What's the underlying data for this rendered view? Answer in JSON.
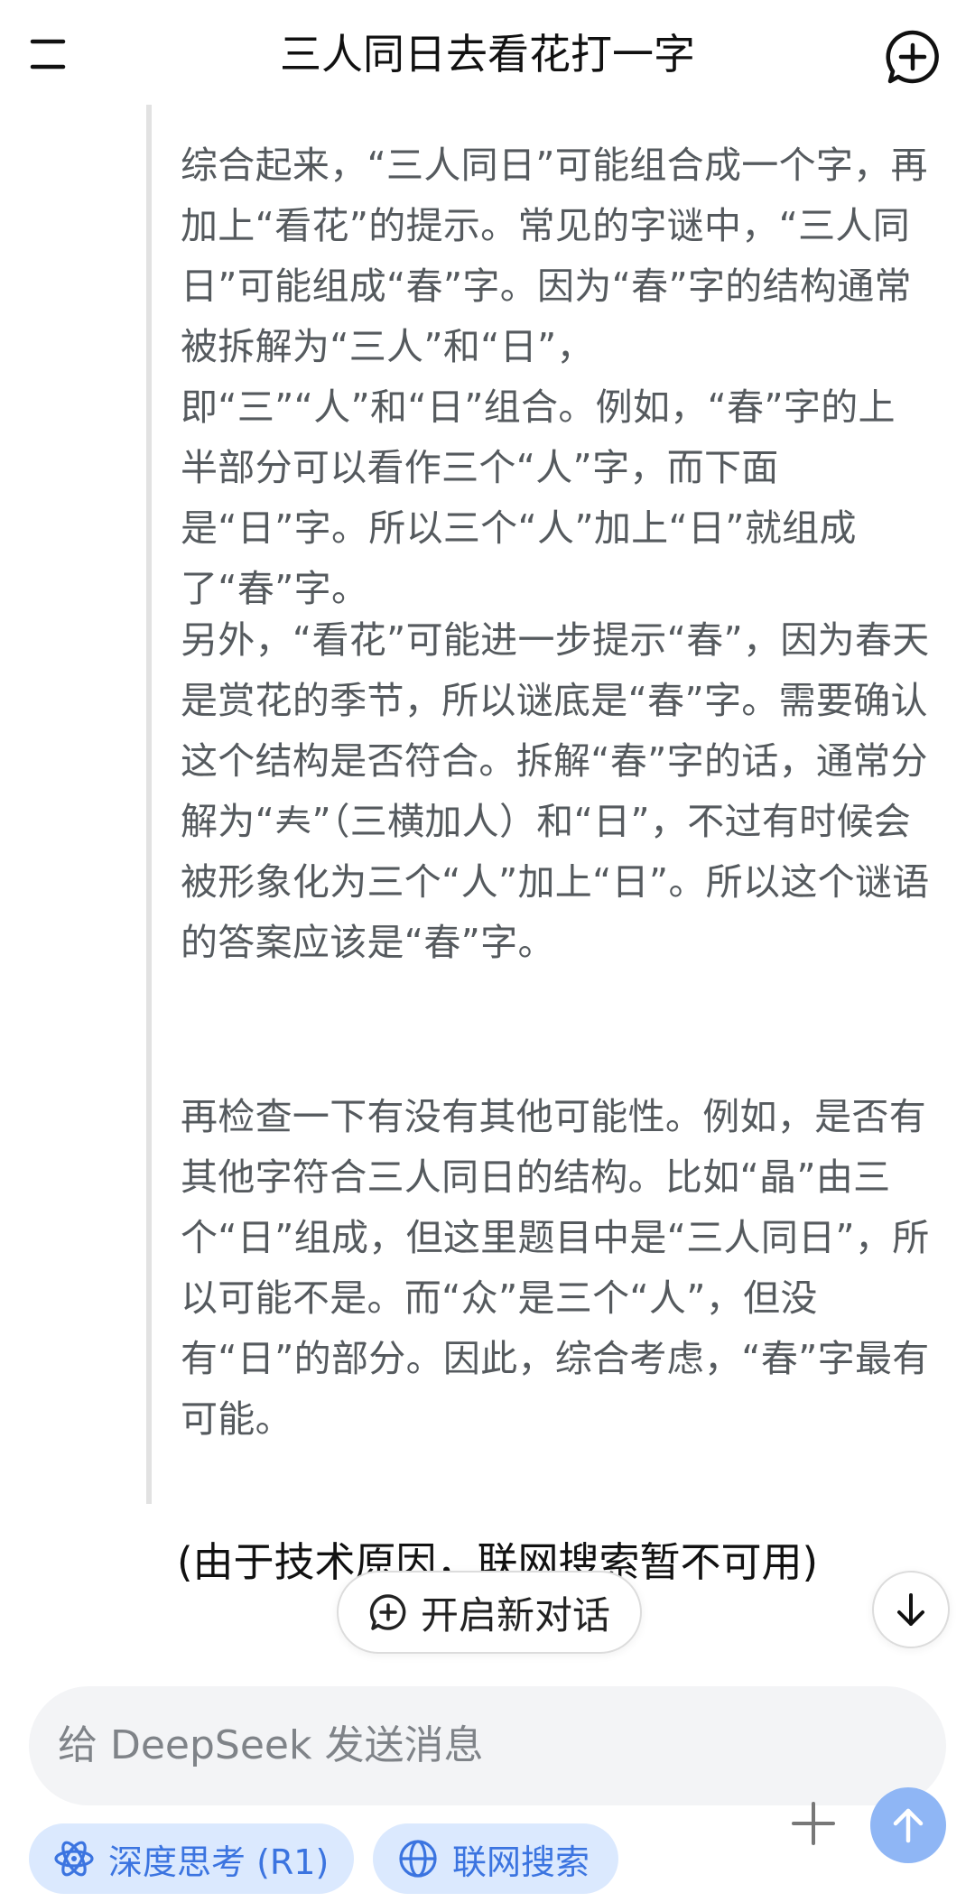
{
  "header": {
    "title": "三人同日去看花打一字"
  },
  "thinking": {
    "paragraphs": [
      "综合起来，“三人同日”可能组合成一个字，再加上“看花”的提示。常见的字谜中，“三人同日”可能组成“春”字。因为“春”字的结构通常被拆解为“三人”和“日”，即“三”“人”和“日”组合。例如，“春”字的上半部分可以看作三个“人”字，而下面是“日”字。所以三个“人”加上“日”就组成了“春”字。",
      "另外，“看花”可能进一步提示“春”，因为春天是赏花的季节，所以谜底是“春”字。需要确认这个结构是否符合。拆解“春”字的话，通常分解为“𡗗”（三横加人）和“日”，不过有时候会被形象化为三个“人”加上“日”。所以这个谜语的答案应该是“春”字。",
      "再检查一下有没有其他可能性。例如，是否有其他字符合三人同日的结构。比如“晶”由三个“日”组成，但这里题目中是“三人同日”，所以可能不是。而“众”是三个“人”，但没有“日”的部分。因此，综合考虑，“春”字最有可能。"
    ]
  },
  "answer": {
    "text": "(由于技术原因，联网搜索暂不可用)"
  },
  "floating": {
    "new_dialog_label": "开启新对话"
  },
  "composer": {
    "placeholder": "给 DeepSeek 发送消息",
    "deep_think_label": "深度思考 (R1)",
    "web_search_label": "联网搜索"
  },
  "colors": {
    "accent": "#3b74e0",
    "chip_bg": "#dbe9fe",
    "send_bg": "#8fb6f5"
  }
}
